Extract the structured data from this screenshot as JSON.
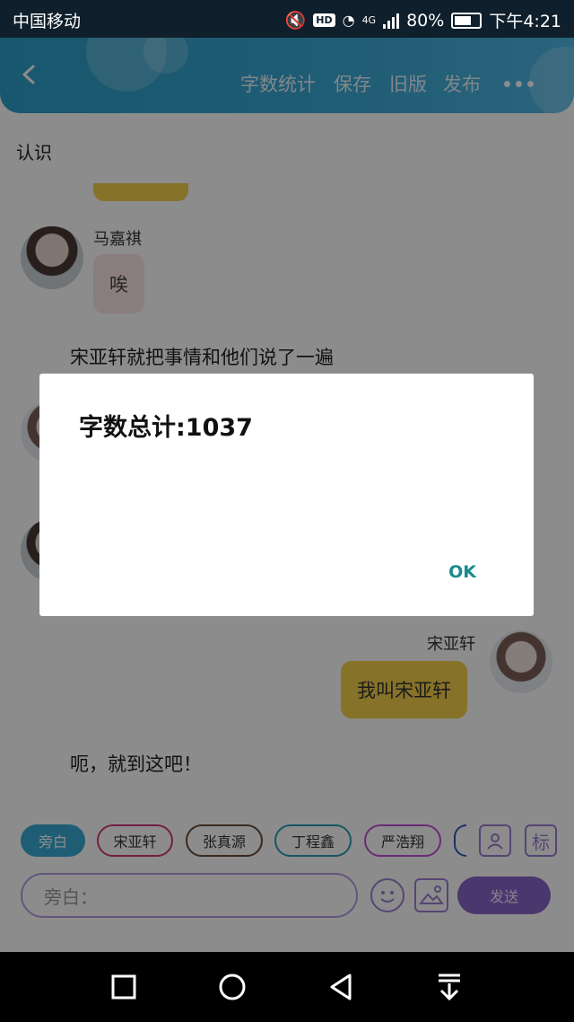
{
  "status_bar": {
    "carrier": "中国移动",
    "battery_percent": "80%",
    "time": "下午4:21",
    "network": "4G",
    "hd": "HD"
  },
  "header": {
    "nav": [
      "字数统计",
      "保存",
      "旧版",
      "发布"
    ]
  },
  "page": {
    "title": "认识"
  },
  "chat": {
    "msg1": {
      "name": "马嘉祺",
      "text": "唉"
    },
    "narration1": "宋亚轩就把事情和他们说了一遍",
    "msg2": {
      "name": "宋亚轩",
      "text": "我叫宋亚轩"
    },
    "narration2": "呃，就到这吧！"
  },
  "dialog": {
    "message": "字数总计:1037",
    "ok_label": "OK"
  },
  "role_chips": [
    "旁白",
    "宋亚轩",
    "张真源",
    "丁程鑫",
    "严浩翔"
  ],
  "tag_label": "标",
  "input": {
    "placeholder": "旁白："
  },
  "send_label": "发送",
  "colors": {
    "header": "#3aa9d6",
    "accent": "#8a63c8",
    "dialog_ok": "#1a8a8a",
    "bubble_self": "#f4cf4a"
  }
}
